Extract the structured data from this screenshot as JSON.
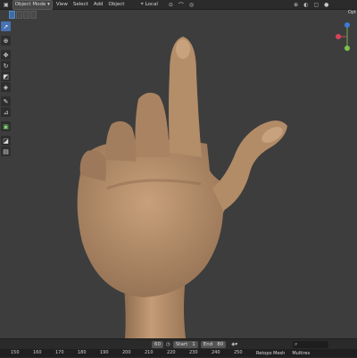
{
  "header": {
    "mode": "Object Mode",
    "menus": [
      "View",
      "Select",
      "Add",
      "Object"
    ],
    "transform_space": "Local",
    "right_label": "Opt"
  },
  "timeline": {
    "current_frame": "60",
    "start_label": "Start",
    "start_value": "1",
    "end_label": "End",
    "end_value": "80",
    "ruler_ticks": [
      "150",
      "160",
      "170",
      "180",
      "190",
      "200",
      "210",
      "220",
      "230",
      "240",
      "250"
    ]
  },
  "status_bar": {
    "items": [
      "Retopo Mesh",
      "Multires"
    ]
  },
  "colors": {
    "header_bg": "#2b2b2b",
    "viewport_bg": "#3d3d3d",
    "active_tool": "#4772b3",
    "skin": "#b08a66"
  },
  "icons": [
    "cursor-icon",
    "move-icon",
    "rotate-icon",
    "scale-icon",
    "transform-icon",
    "annotate-icon",
    "measure-icon"
  ]
}
